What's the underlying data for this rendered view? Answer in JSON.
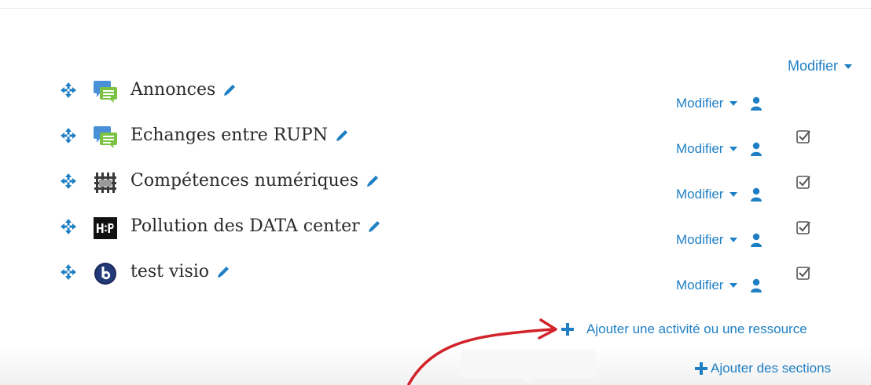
{
  "section": {
    "edit_label": "Modifier"
  },
  "activities": [
    {
      "name": "Annonces",
      "edit_label": "Modifier",
      "icon": "forum-icon",
      "completion": false
    },
    {
      "name": "Echanges entre RUPN",
      "edit_label": "Modifier",
      "icon": "forum-icon",
      "completion": true
    },
    {
      "name": "Compétences numériques",
      "edit_label": "Modifier",
      "icon": "glossary-icon",
      "completion": true
    },
    {
      "name": "Pollution des DATA center",
      "edit_label": "Modifier",
      "icon": "h5p-icon",
      "completion": true
    },
    {
      "name": "test visio",
      "edit_label": "Modifier",
      "icon": "bigbluebutton-icon",
      "completion": true
    }
  ],
  "add_activity_label": "Ajouter une activité ou une ressource",
  "add_sections_label": "Ajouter des sections",
  "colors": {
    "link": "#1f7fc4",
    "annotation_arrow": "#d2232a"
  }
}
